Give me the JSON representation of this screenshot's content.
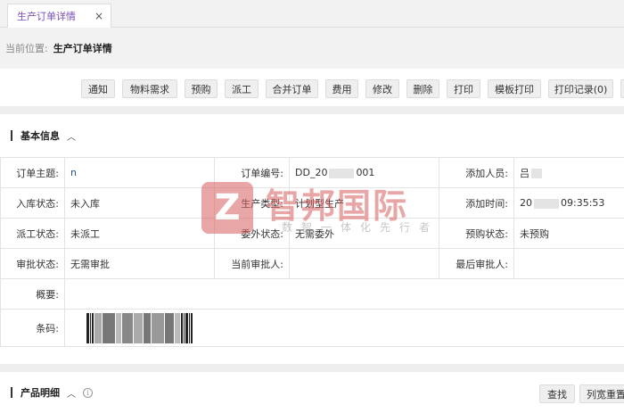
{
  "tab": {
    "label": "生产订单详情",
    "close": "×"
  },
  "breadcrumb": {
    "prefix": "当前位置:",
    "current": "生产订单详情"
  },
  "toolbar": {
    "buttons": [
      "通知",
      "物料需求",
      "预购",
      "派工",
      "合并订单",
      "费用",
      "修改",
      "删除",
      "打印",
      "模板打印",
      "打印记录(0)"
    ]
  },
  "basic_info": {
    "title": "基本信息",
    "rows": [
      {
        "l1": "订单主题:",
        "v1": "n",
        "l2": "订单编号:",
        "v2_pre": "DD_20",
        "v2_post": "001",
        "l3": "添加人员:",
        "v3": "吕"
      },
      {
        "l1": "入库状态:",
        "v1": "未入库",
        "l2": "生产类型:",
        "v2": "计划型生产",
        "l3": "添加时间:",
        "v3_pre": "20",
        "v3_post": "09:35:53"
      },
      {
        "l1": "派工状态:",
        "v1": "未派工",
        "l2": "委外状态:",
        "v2": "无需委外",
        "l3": "预购状态:",
        "v3": "未预购"
      },
      {
        "l1": "审批状态:",
        "v1": "无需审批",
        "l2": "当前审批人:",
        "v2": "",
        "l3": "最后审批人:",
        "v3": ""
      }
    ],
    "summary_label": "概要:",
    "summary_value": "",
    "barcode_label": "条码:"
  },
  "product_detail": {
    "title": "产品明细",
    "search_label": "查找",
    "reset_label": "列宽重置"
  },
  "watermark": {
    "logo_letter": "Z",
    "brand": "智邦国际",
    "slogan": "数智一体化先行者"
  }
}
